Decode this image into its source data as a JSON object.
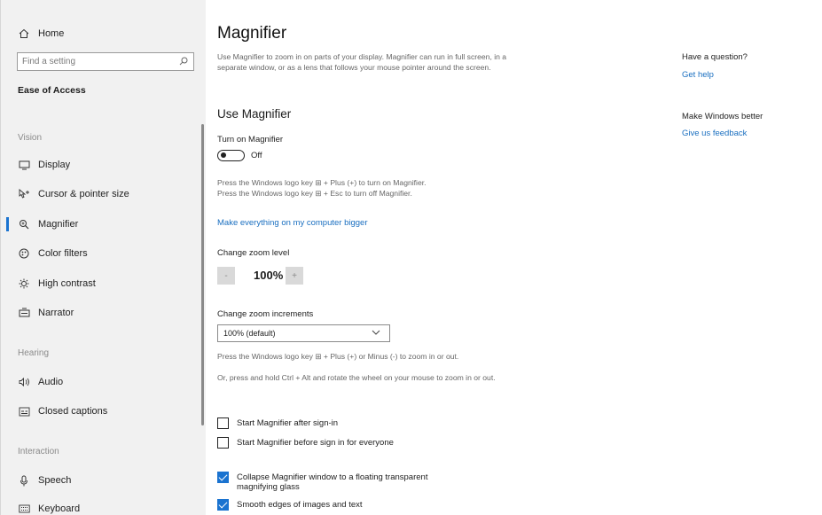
{
  "sidebar": {
    "home_label": "Home",
    "search_placeholder": "Find a setting",
    "category_title": "Ease of Access",
    "sections": {
      "vision": "Vision",
      "hearing": "Hearing",
      "interaction": "Interaction"
    },
    "items": {
      "display": "Display",
      "cursor": "Cursor & pointer size",
      "magnifier": "Magnifier",
      "color_filters": "Color filters",
      "high_contrast": "High contrast",
      "narrator": "Narrator",
      "audio": "Audio",
      "closed_captions": "Closed captions",
      "speech": "Speech",
      "keyboard": "Keyboard"
    },
    "active_item": "magnifier",
    "accent_color": "#1a73d0"
  },
  "main": {
    "title": "Magnifier",
    "description": "Use Magnifier to zoom in on parts of your display. Magnifier can run in full screen, in a separate window, or as a lens that follows your mouse pointer around the screen.",
    "section_title": "Use Magnifier",
    "turn_on_label": "Turn on Magnifier",
    "toggle_state": "Off",
    "shortcut_hint_1": "Press the Windows logo key ⊞ + Plus (+) to turn on Magnifier.",
    "shortcut_hint_2": "Press the Windows logo key ⊞ + Esc to turn off Magnifier.",
    "bigger_link": "Make everything on my computer bigger",
    "zoom_level_label": "Change zoom level",
    "zoom_minus": "-",
    "zoom_value": "100%",
    "zoom_plus": "+",
    "zoom_increments_label": "Change zoom increments",
    "zoom_increments_value": "100% (default)",
    "zoom_hint_1": "Press the Windows logo key ⊞ + Plus (+) or Minus (-) to zoom in or out.",
    "zoom_hint_2": "Or, press and hold Ctrl + Alt and rotate the wheel on your mouse to zoom in or out.",
    "checkboxes": [
      {
        "label": "Start Magnifier after sign-in",
        "checked": false
      },
      {
        "label": "Start Magnifier before sign in for everyone",
        "checked": false
      },
      {
        "label": "Collapse Magnifier window to a floating transparent magnifying glass",
        "checked": true
      },
      {
        "label": "Smooth edges of images and text",
        "checked": true
      }
    ]
  },
  "aside": {
    "question_heading": "Have a question?",
    "help_link": "Get help",
    "better_heading": "Make Windows better",
    "feedback_link": "Give us feedback"
  }
}
